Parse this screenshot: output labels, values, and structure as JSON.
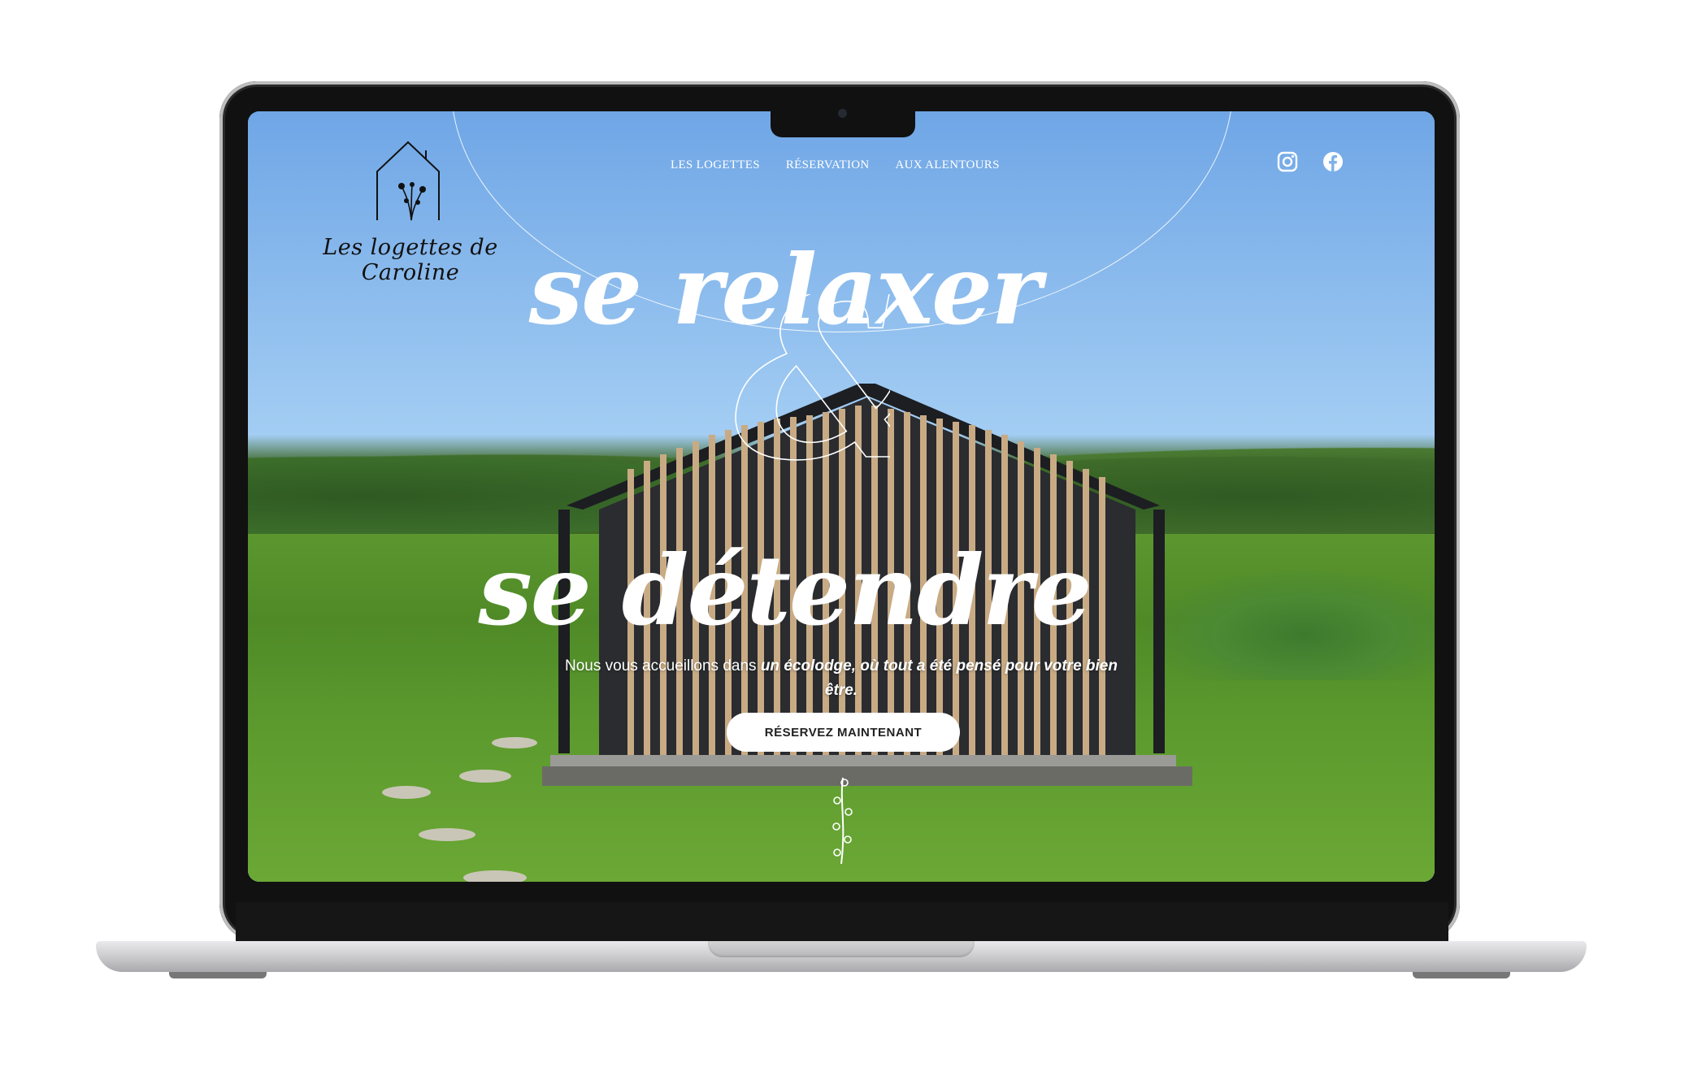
{
  "site": {
    "logo_text": "Les logettes de Caroline"
  },
  "nav": {
    "items": [
      "LES LOGETTES",
      "RÉSERVATION",
      "AUX ALENTOURS"
    ]
  },
  "social": {
    "icons": [
      "instagram-icon",
      "facebook-icon"
    ]
  },
  "hero": {
    "line1": "se relaxer",
    "ampersand": "&",
    "line2": "se détendre",
    "tagline_plain": "Nous vous accueillons dans ",
    "tagline_emphasis": "un écolodge, où tout a été pensé pour votre bien être.",
    "cta_label": "RÉSERVEZ MAINTENANT"
  },
  "colors": {
    "text_light": "#ffffff",
    "button_bg": "#ffffff",
    "button_text": "#222222",
    "device_frame": "#111111"
  }
}
